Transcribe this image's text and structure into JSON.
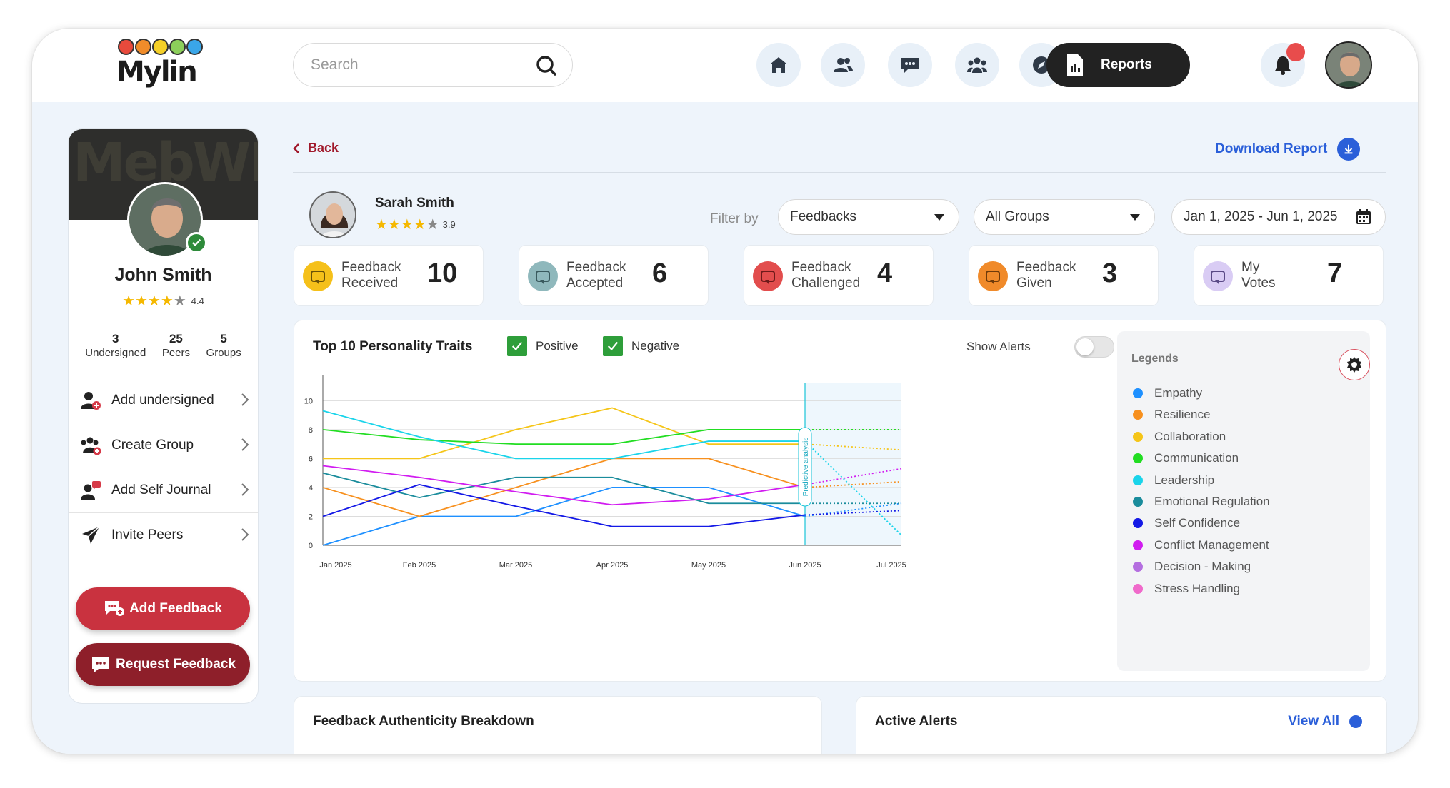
{
  "app": {
    "name": "Mylin"
  },
  "header": {
    "search_placeholder": "Search",
    "nav": [
      "home-icon",
      "peers-icon",
      "chat-icon",
      "groups-icon",
      "compass-icon"
    ],
    "reports_label": "Reports"
  },
  "profile": {
    "name": "John Smith",
    "rating": "4.4",
    "stats": [
      {
        "value": "3",
        "label": "Undersigned"
      },
      {
        "value": "25",
        "label": "Peers"
      },
      {
        "value": "5",
        "label": "Groups"
      }
    ],
    "menu": [
      {
        "label": "Add undersigned",
        "icon": "add-user-icon"
      },
      {
        "label": "Create Group",
        "icon": "create-group-icon"
      },
      {
        "label": "Add Self Journal",
        "icon": "journal-icon"
      },
      {
        "label": "Invite Peers",
        "icon": "send-icon"
      }
    ],
    "add_feedback": "Add Feedback",
    "request_feedback": "Request Feedback"
  },
  "main": {
    "back_label": "Back",
    "download_label": "Download Report",
    "subject": {
      "name": "Sarah Smith",
      "rating": "3.9"
    },
    "filter_label": "Filter by",
    "filters": {
      "type": "Feedbacks",
      "group": "All Groups",
      "date": "Jan 1, 2025 - Jun 1, 2025"
    },
    "cards": [
      {
        "label": "Feedback\nReceived",
        "value": "10",
        "color": "#f5c01a"
      },
      {
        "label": "Feedback\nAccepted",
        "value": "6",
        "color": "#8fb8bc"
      },
      {
        "label": "Feedback\nChallenged",
        "value": "4",
        "color": "#e24d4d"
      },
      {
        "label": "Feedback\nGiven",
        "value": "3",
        "color": "#f08a2a"
      },
      {
        "label": "My\nVotes",
        "value": "7",
        "color": "#c6b4ee"
      }
    ]
  },
  "chart_panel": {
    "title": "Top 10 Personality Traits",
    "positive_label": "Positive",
    "negative_label": "Negative",
    "show_alerts_label": "Show Alerts",
    "show_alerts_on": false,
    "legend_title": "Legends",
    "predictive_label": "Predictive analysis"
  },
  "chart_data": {
    "type": "line",
    "x": [
      "Jan 2025",
      "Feb 2025",
      "Mar 2025",
      "Apr 2025",
      "May 2025",
      "Jun 2025",
      "Jul 2025"
    ],
    "yticks": [
      0,
      2,
      4,
      6,
      8,
      10
    ],
    "ylim": [
      0,
      11.2
    ],
    "forecast_from": "Jun 2025",
    "series": [
      {
        "name": "Empathy",
        "color": "#1e90ff",
        "values": [
          0,
          2,
          2,
          4,
          4,
          2
        ],
        "forecast": 2.9
      },
      {
        "name": "Resilience",
        "color": "#f7901e",
        "values": [
          4,
          2,
          4,
          6,
          6,
          4
        ],
        "forecast": 4.4
      },
      {
        "name": "Collaboration",
        "color": "#f5c518",
        "values": [
          6,
          6,
          8,
          9.5,
          7,
          7
        ],
        "forecast": 6.6
      },
      {
        "name": "Communication",
        "color": "#22dd22",
        "values": [
          8,
          7.3,
          7,
          7,
          8,
          8
        ],
        "forecast": 8
      },
      {
        "name": "Leadership",
        "color": "#1ad4ea",
        "values": [
          9.3,
          7.5,
          6,
          6,
          7.2,
          7.2
        ],
        "forecast": 0.7
      },
      {
        "name": "Emotional Regulation",
        "color": "#1a8c9c",
        "values": [
          5,
          3.3,
          4.7,
          4.7,
          2.9,
          2.9
        ],
        "forecast": 2.9
      },
      {
        "name": "Self Confidence",
        "color": "#1419e6",
        "values": [
          2,
          4.2,
          2.7,
          1.3,
          1.3,
          2.1
        ],
        "forecast": 2.4
      },
      {
        "name": "Conflict Management",
        "color": "#d11cf0",
        "values": [
          5.5,
          4.7,
          3.7,
          2.8,
          3.2,
          4.2
        ],
        "forecast": 5.3
      },
      {
        "name": "Decision - Making",
        "color": "#b46ee0",
        "values": [],
        "forecast": null
      },
      {
        "name": "Stress Handling",
        "color": "#f06acb",
        "values": [],
        "forecast": null
      }
    ]
  },
  "bottom": {
    "authenticity_title": "Feedback Authenticity Breakdown",
    "alerts_title": "Active Alerts",
    "view_all": "View All"
  }
}
